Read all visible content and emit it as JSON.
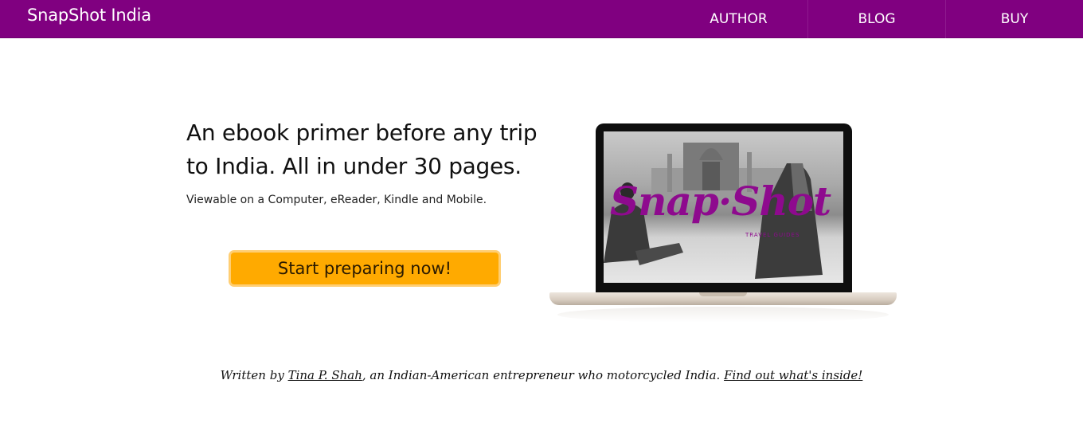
{
  "nav": {
    "brand": "SnapShot India",
    "links": [
      {
        "label": "AUTHOR"
      },
      {
        "label": "BLOG"
      },
      {
        "label": "BUY"
      }
    ]
  },
  "hero": {
    "headline": "An ebook primer before any trip to India. All in under 30 pages.",
    "subtext": "Viewable on a Computer, eReader, Kindle and Mobile.",
    "cta_label": "Start preparing now!"
  },
  "laptop_screen": {
    "logo": "Snap·Shot",
    "logo_sub": "TRAVEL GUIDES"
  },
  "byline": {
    "prefix": "Written by ",
    "author_link": "Tina P. Shah",
    "middle": ", an Indian-American entrepreneur who motorcycled India. ",
    "inside_link": "Find out what's inside!"
  },
  "colors": {
    "nav_bg": "#800080",
    "cta_bg": "#ffaa00",
    "logo": "#8e0a8e"
  }
}
